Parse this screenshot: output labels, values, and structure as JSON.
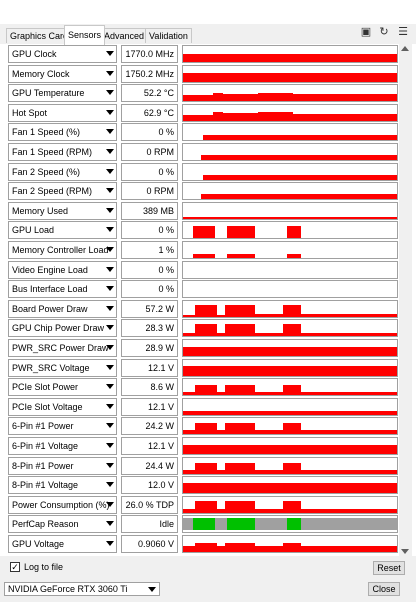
{
  "tabs": [
    {
      "label": "Graphics Card"
    },
    {
      "label": "Sensors"
    },
    {
      "label": "Advanced"
    },
    {
      "label": "Validation"
    }
  ],
  "toolbar_icons": [
    "camera-icon",
    "refresh-icon",
    "menu-icon"
  ],
  "colors": {
    "graph": "#ff0000",
    "perfcap_idle": "#a0a0a0",
    "perfcap_limit": "#00c000"
  },
  "sensors": [
    {
      "label": "GPU Clock",
      "value": "1770.0 MHz"
    },
    {
      "label": "Memory Clock",
      "value": "1750.2 MHz"
    },
    {
      "label": "GPU Temperature",
      "value": "52.2 °C"
    },
    {
      "label": "Hot Spot",
      "value": "62.9 °C"
    },
    {
      "label": "Fan 1 Speed (%)",
      "value": "0 %"
    },
    {
      "label": "Fan 1 Speed (RPM)",
      "value": "0 RPM"
    },
    {
      "label": "Fan 2 Speed (%)",
      "value": "0 %"
    },
    {
      "label": "Fan 2 Speed (RPM)",
      "value": "0 RPM"
    },
    {
      "label": "Memory Used",
      "value": "389 MB"
    },
    {
      "label": "GPU Load",
      "value": "0 %"
    },
    {
      "label": "Memory Controller Load",
      "value": "1 %"
    },
    {
      "label": "Video Engine Load",
      "value": "0 %"
    },
    {
      "label": "Bus Interface Load",
      "value": "0 %"
    },
    {
      "label": "Board Power Draw",
      "value": "57.2 W"
    },
    {
      "label": "GPU Chip Power Draw",
      "value": "28.3 W"
    },
    {
      "label": "PWR_SRC Power Draw",
      "value": "28.9 W"
    },
    {
      "label": "PWR_SRC Voltage",
      "value": "12.1 V"
    },
    {
      "label": "PCIe Slot Power",
      "value": "8.6 W"
    },
    {
      "label": "PCIe Slot Voltage",
      "value": "12.1 V"
    },
    {
      "label": "6-Pin #1 Power",
      "value": "24.2 W"
    },
    {
      "label": "6-Pin #1 Voltage",
      "value": "12.1 V"
    },
    {
      "label": "8-Pin #1 Power",
      "value": "24.4 W"
    },
    {
      "label": "8-Pin #1 Voltage",
      "value": "12.0 V"
    },
    {
      "label": "Power Consumption (%)",
      "value": "26.0 % TDP"
    },
    {
      "label": "PerfCap Reason",
      "value": "Idle"
    },
    {
      "label": "GPU Voltage",
      "value": "0.9060 V"
    }
  ],
  "log_to_file": {
    "label": "Log to file",
    "checked": true
  },
  "reset_label": "Reset",
  "gpu_select": {
    "value": "NVIDIA GeForce RTX 3060 Ti"
  },
  "close_label": "Close"
}
